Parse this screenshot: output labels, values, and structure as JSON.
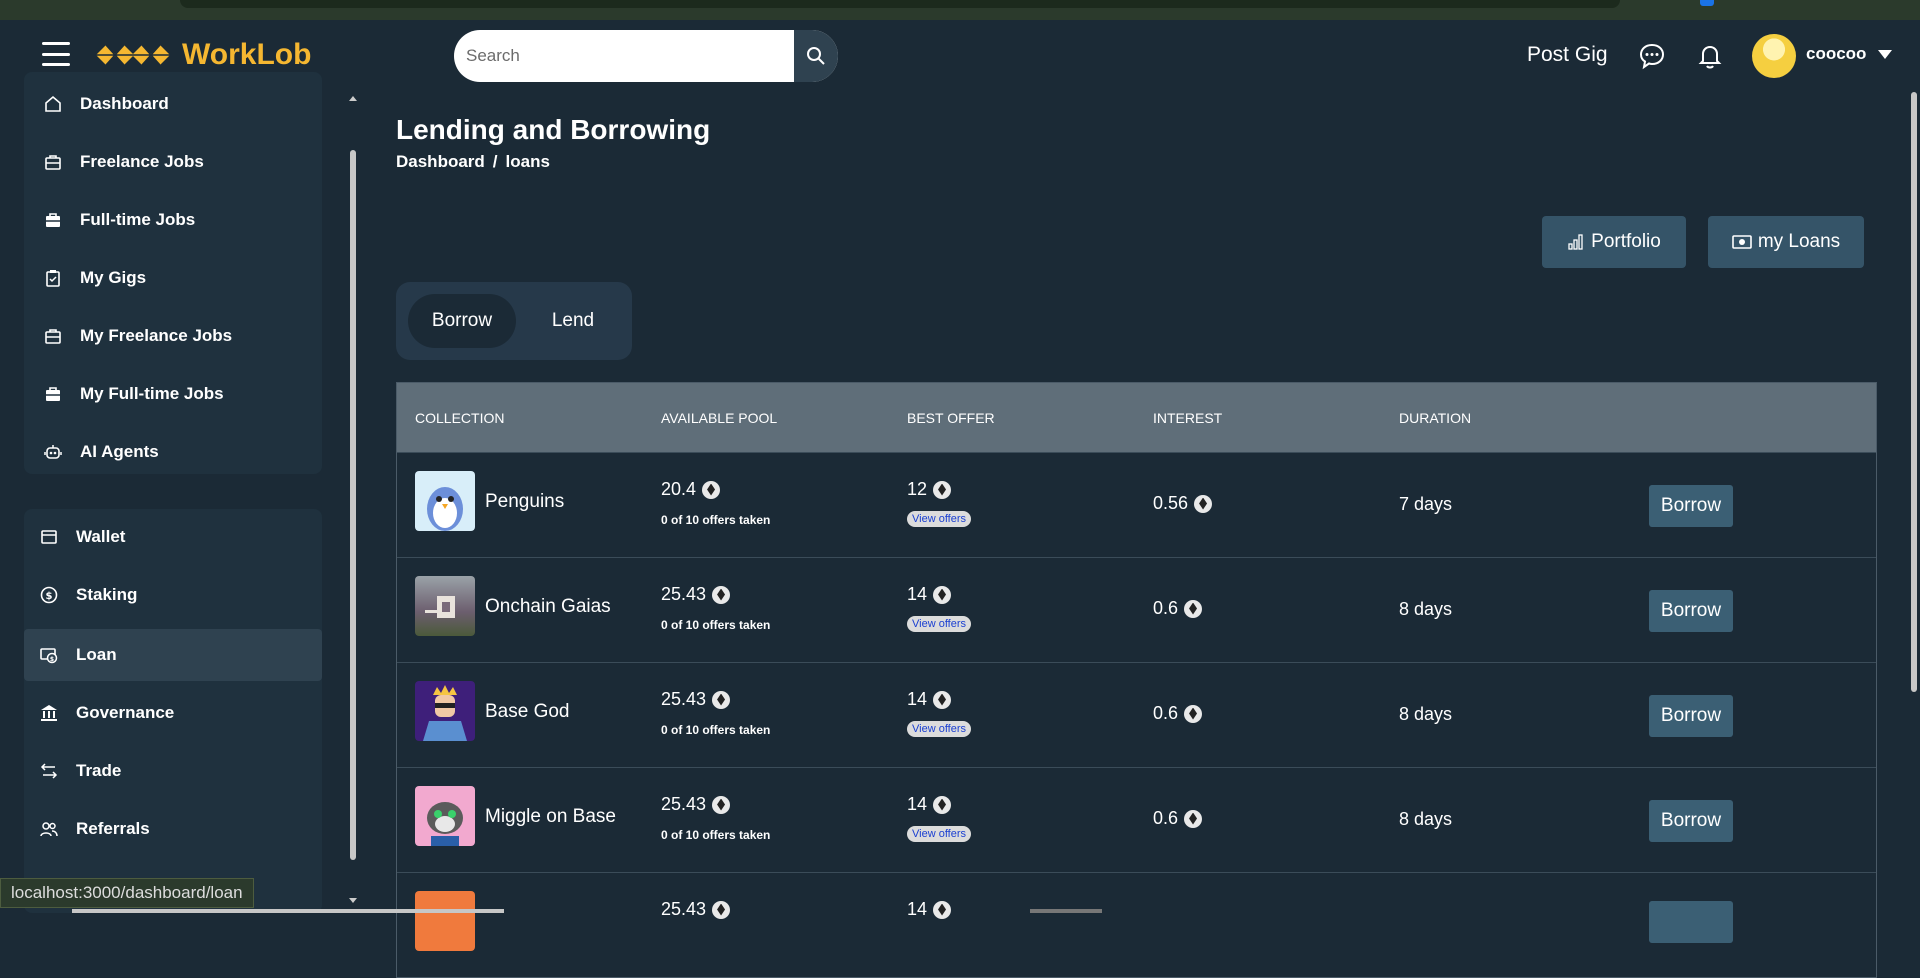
{
  "app": {
    "brand": "WorkLob"
  },
  "header": {
    "search_placeholder": "Search",
    "post_gig": "Post Gig",
    "username": "coocoo"
  },
  "sidebar": {
    "group1": [
      {
        "label": "Dashboard",
        "icon": "home-icon"
      },
      {
        "label": "Freelance Jobs",
        "icon": "briefcase-icon"
      },
      {
        "label": "Full-time Jobs",
        "icon": "briefcase-filled-icon"
      },
      {
        "label": "My Gigs",
        "icon": "clipboard-icon"
      },
      {
        "label": "My Freelance Jobs",
        "icon": "briefcase-icon"
      },
      {
        "label": "My Full-time Jobs",
        "icon": "briefcase-filled-icon"
      },
      {
        "label": "AI Agents",
        "icon": "robot-icon"
      }
    ],
    "group2": [
      {
        "label": "Wallet",
        "icon": "wallet-icon"
      },
      {
        "label": "Staking",
        "icon": "dollar-coin-icon"
      },
      {
        "label": "Loan",
        "icon": "loan-icon",
        "active": true
      },
      {
        "label": "Governance",
        "icon": "bank-icon"
      },
      {
        "label": "Trade",
        "icon": "swap-icon"
      },
      {
        "label": "Referrals",
        "icon": "users-icon"
      }
    ]
  },
  "page": {
    "title": "Lending and Borrowing",
    "breadcrumb": [
      "Dashboard",
      "/",
      "loans"
    ],
    "portfolio_btn": "Portfolio",
    "myloans_btn": "my Loans",
    "toggle": {
      "borrow": "Borrow",
      "lend": "Lend",
      "selected": "Borrow"
    }
  },
  "table": {
    "headers": [
      "COLLECTION",
      "AVAILABLE POOL",
      "BEST OFFER",
      "INTEREST",
      "DURATION"
    ],
    "rows": [
      {
        "collection": "Penguins",
        "pool": "20.4",
        "offers_taken": "0 of 10 offers taken",
        "best_offer": "12",
        "view_offers": "View offers",
        "interest": "0.56",
        "duration": "7 days",
        "action": "Borrow"
      },
      {
        "collection": "Onchain Gaias",
        "pool": "25.43",
        "offers_taken": "0 of 10 offers taken",
        "best_offer": "14",
        "view_offers": "View offers",
        "interest": "0.6",
        "duration": "8 days",
        "action": "Borrow"
      },
      {
        "collection": "Base God",
        "pool": "25.43",
        "offers_taken": "0 of 10 offers taken",
        "best_offer": "14",
        "view_offers": "View offers",
        "interest": "0.6",
        "duration": "8 days",
        "action": "Borrow"
      },
      {
        "collection": "Miggle on Base",
        "pool": "25.43",
        "offers_taken": "0 of 10 offers taken",
        "best_offer": "14",
        "view_offers": "View offers",
        "interest": "0.6",
        "duration": "8 days",
        "action": "Borrow"
      },
      {
        "collection": "",
        "pool": "25.43",
        "offers_taken": "",
        "best_offer": "14",
        "view_offers": "",
        "interest": "",
        "duration": "",
        "action": ""
      }
    ]
  },
  "status_url": "localhost:3000/dashboard/loan",
  "colors": {
    "brand": "#f5b731",
    "bg": "#1b2a36",
    "accent_button": "#3b5f74"
  }
}
